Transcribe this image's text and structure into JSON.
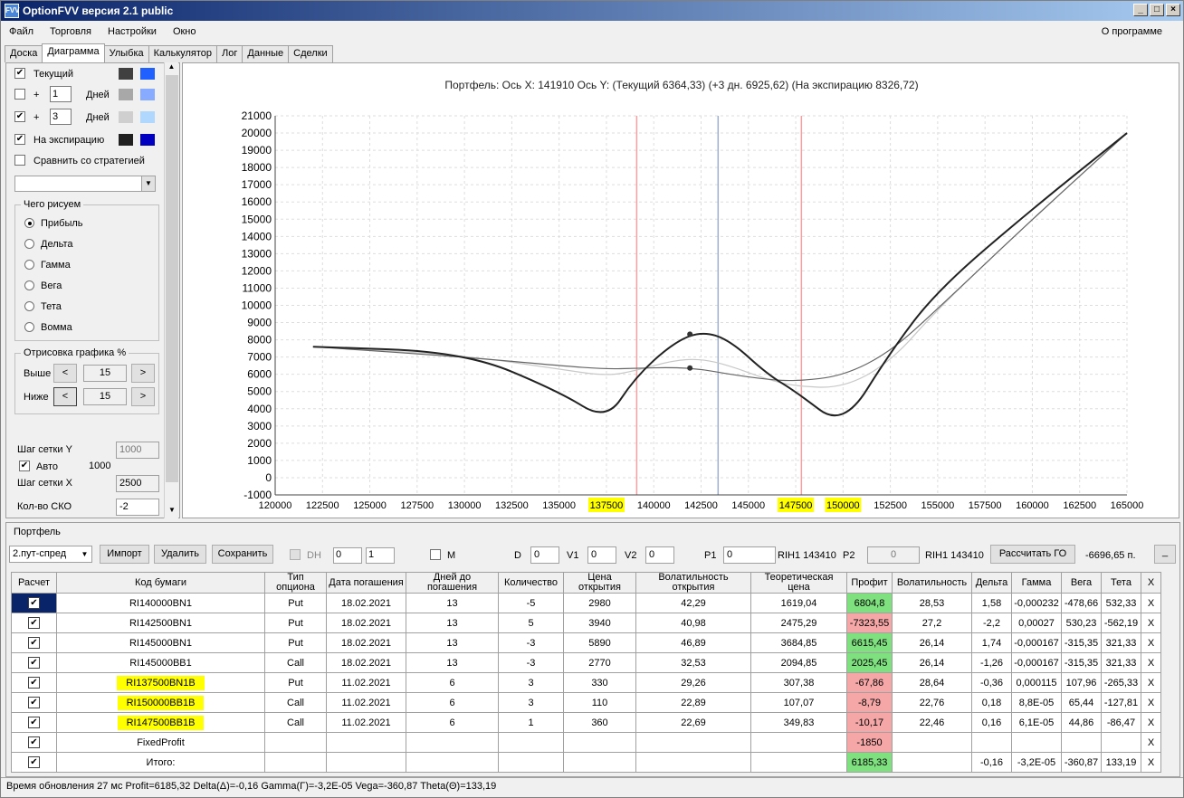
{
  "window": {
    "title": "OptionFVV версия 2.1 public"
  },
  "menu": [
    "Файл",
    "Торговля",
    "Настройки",
    "Окно"
  ],
  "menu_right": "О программе",
  "tabs": [
    "Доска",
    "Диаграмма",
    "Улыбка",
    "Калькулятор",
    "Лог",
    "Данные",
    "Сделки"
  ],
  "left": {
    "current": "Текущий",
    "plus": "+",
    "days1": "1",
    "days": "Дней",
    "days3": "3",
    "expiry": "На экспирацию",
    "compare": "Сравнить со стратегией",
    "what_title": "Чего рисуем",
    "radios": [
      "Прибыль",
      "Дельта",
      "Гамма",
      "Вега",
      "Тета",
      "Вомма"
    ],
    "draw_title": "Отрисовка графика %",
    "above": "Выше",
    "below": "Ниже",
    "above_val": "15",
    "below_val": "15",
    "lt": "<",
    "gt": ">",
    "grid_y": "Шаг сетки Y",
    "grid_y_val": "1000",
    "auto": "Авто",
    "auto_val": "1000",
    "grid_x": "Шаг сетки X",
    "grid_x_val": "2500",
    "sko": "Кол-во СКО",
    "sko_val": "-2"
  },
  "chart_data": {
    "type": "line",
    "title": "Портфель: Ось X: 141910 Ось Y: (Текущий 6364,33) (+3 дн. 6925,62) (На экспирацию 8326,72)",
    "xticks": [
      "120000",
      "122500",
      "125000",
      "127500",
      "130000",
      "132500",
      "135000",
      "137500",
      "140000",
      "142500",
      "145000",
      "147500",
      "150000",
      "152500",
      "155000",
      "157500",
      "160000",
      "162500",
      "165000"
    ],
    "yticks": [
      "21000",
      "20000",
      "19000",
      "18000",
      "17000",
      "16000",
      "15000",
      "14000",
      "13000",
      "12000",
      "11000",
      "10000",
      "9000",
      "8000",
      "7000",
      "6000",
      "5000",
      "4000",
      "3000",
      "2000",
      "1000",
      "0",
      "-1000"
    ],
    "highlighted_x": [
      "137500",
      "147500",
      "150000"
    ],
    "xlim": [
      120000,
      165000
    ],
    "ylim": [
      -1000,
      21000
    ],
    "series": [
      {
        "color": "#222222",
        "x": [
          122000,
          130000,
          135000,
          137500,
          139000,
          141000,
          142500,
          144000,
          146000,
          147500,
          150000,
          152500,
          155000,
          160000,
          165000
        ],
        "values": [
          7600,
          7300,
          5000,
          3300,
          5800,
          7800,
          8500,
          8000,
          6000,
          5000,
          2900,
          7300,
          10900,
          15600,
          20000
        ]
      },
      {
        "color": "#666666",
        "x": [
          122000,
          130000,
          135000,
          137500,
          139000,
          141000,
          142500,
          144000,
          146000,
          147500,
          150000,
          152500,
          155000,
          160000,
          165000
        ],
        "values": [
          7600,
          7000,
          6500,
          6300,
          6350,
          6400,
          6300,
          6000,
          5700,
          5600,
          5900,
          7300,
          9800,
          15000,
          20000
        ]
      },
      {
        "color": "#c8c8c8",
        "x": [
          122000,
          130000,
          135000,
          137500,
          139000,
          141000,
          142500,
          144000,
          146000,
          147500,
          150000,
          152500,
          155000,
          160000,
          165000
        ],
        "values": [
          7600,
          7100,
          6300,
          5900,
          6200,
          6800,
          6900,
          6500,
          5700,
          5300,
          5200,
          6700,
          9800,
          15000,
          20000
        ]
      }
    ],
    "vlines": [
      {
        "x": 139100,
        "color": "#f5a0a0"
      },
      {
        "x": 143400,
        "color": "#a0b0c8"
      },
      {
        "x": 147800,
        "color": "#f5a0a0"
      }
    ],
    "points": [
      {
        "x": 141910,
        "y": 8326
      },
      {
        "x": 141910,
        "y": 6364
      }
    ]
  },
  "portfolio": {
    "title": "Портфель",
    "strategy": "2.пут-спред",
    "import": "Импорт",
    "delete": "Удалить",
    "save": "Сохранить",
    "dh": "DH",
    "dh1": "0",
    "dh2": "1",
    "m": "M",
    "d": "D",
    "d_val": "0",
    "v1": "V1",
    "v1_val": "0",
    "v2": "V2",
    "v2_val": "0",
    "p1": "P1",
    "p1_val": "0",
    "rih1a": "RIH1 143410",
    "p2": "P2",
    "p2_val": "0",
    "rih1b": "RIH1 143410",
    "calc_go": "Рассчитать ГО",
    "go_val": "-6696,65 п.",
    "min": "_"
  },
  "table": {
    "headers": [
      "Расчет",
      "Код бумаги",
      "Тип опциона",
      "Дата погашения",
      "Дней до погашения",
      "Количество",
      "Цена открытия",
      "Волатильность открытия",
      "Теоретическая цена",
      "Профит",
      "Волатильность",
      "Дельта",
      "Гамма",
      "Вега",
      "Тета",
      "X"
    ],
    "rows": [
      [
        "RI140000BN1",
        "Put",
        "18.02.2021",
        "13",
        "-5",
        "2980",
        "42,29",
        "1619,04",
        "6804,8",
        "28,53",
        "1,58",
        "-0,000232",
        "-478,66",
        "532,33"
      ],
      [
        "RI142500BN1",
        "Put",
        "18.02.2021",
        "13",
        "5",
        "3940",
        "40,98",
        "2475,29",
        "-7323,55",
        "27,2",
        "-2,2",
        "0,00027",
        "530,23",
        "-562,19"
      ],
      [
        "RI145000BN1",
        "Put",
        "18.02.2021",
        "13",
        "-3",
        "5890",
        "46,89",
        "3684,85",
        "6615,45",
        "26,14",
        "1,74",
        "-0,000167",
        "-315,35",
        "321,33"
      ],
      [
        "RI145000BB1",
        "Call",
        "18.02.2021",
        "13",
        "-3",
        "2770",
        "32,53",
        "2094,85",
        "2025,45",
        "26,14",
        "-1,26",
        "-0,000167",
        "-315,35",
        "321,33"
      ],
      [
        "RI137500BN1B",
        "Put",
        "11.02.2021",
        "6",
        "3",
        "330",
        "29,26",
        "307,38",
        "-67,86",
        "28,64",
        "-0,36",
        "0,000115",
        "107,96",
        "-265,33"
      ],
      [
        "RI150000BB1B",
        "Call",
        "11.02.2021",
        "6",
        "3",
        "110",
        "22,89",
        "107,07",
        "-8,79",
        "22,76",
        "0,18",
        "8,8E-05",
        "65,44",
        "-127,81"
      ],
      [
        "RI147500BB1B",
        "Call",
        "11.02.2021",
        "6",
        "1",
        "360",
        "22,69",
        "349,83",
        "-10,17",
        "22,46",
        "0,16",
        "6,1E-05",
        "44,86",
        "-86,47"
      ],
      [
        "FixedProfit",
        "",
        "",
        "",
        "",
        "",
        "",
        "",
        "-1850",
        "",
        "",
        "",
        "",
        ""
      ],
      [
        "Итого:",
        "",
        "",
        "",
        "",
        "",
        "",
        "",
        "6185,33",
        "",
        "-0,16",
        "-3,2E-05",
        "-360,87",
        "133,19"
      ]
    ],
    "x": "X"
  },
  "status": "Время обновления 27 мс  Profit=6185,32 Delta(Δ)=-0,16 Gamma(Γ)=-3,2E-05 Vega=-360,87 Theta(Θ)=133,19"
}
